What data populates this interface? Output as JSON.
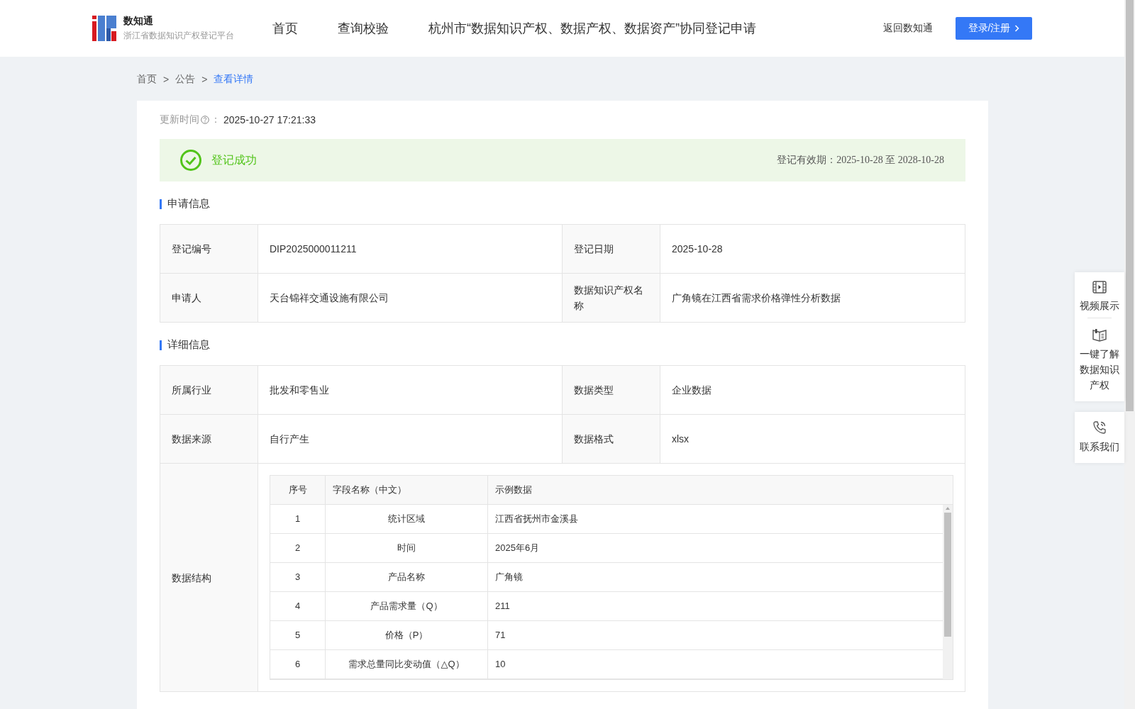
{
  "header": {
    "logo_title": "数知通",
    "logo_subtitle": "浙江省数据知识产权登记平台",
    "nav": [
      {
        "label": "首页"
      },
      {
        "label": "查询校验"
      },
      {
        "label": "杭州市“数据知识产权、数据产权、数据资产”协同登记申请"
      }
    ],
    "back_link": "返回数知通",
    "login_button": "登录/注册"
  },
  "breadcrumb": [
    {
      "kind": "link",
      "label": "首页",
      "selected": false
    },
    {
      "kind": "separator",
      "label": ">"
    },
    {
      "kind": "link",
      "label": "公告",
      "selected": false
    },
    {
      "kind": "separator",
      "label": ">"
    },
    {
      "kind": "link",
      "label": "查看详情",
      "selected": true
    }
  ],
  "update": {
    "label": "更新时间",
    "separator": "：",
    "value": "2025-10-27 17:21:33"
  },
  "status": {
    "kind": "success",
    "text": "登记成功",
    "validity_label": "登记有效期：",
    "validity_value": "2025-10-28 至 2028-10-28"
  },
  "sections": [
    {
      "title": "申请信息",
      "rows": [
        {
          "kind": "pairs",
          "cells": [
            {
              "label": "登记编号",
              "value": "DIP2025000011211"
            },
            {
              "label": "登记日期",
              "value": "2025-10-28"
            }
          ]
        },
        {
          "kind": "pairs",
          "cells": [
            {
              "label": "申请人",
              "value": "天台锦祥交通设施有限公司"
            },
            {
              "label": "数据知识产权名称",
              "value": "广角镜在江西省需求价格弹性分析数据"
            }
          ]
        }
      ]
    },
    {
      "title": "详细信息",
      "rows": [
        {
          "kind": "pairs",
          "cells": [
            {
              "label": "所属行业",
              "value": "批发和零售业"
            },
            {
              "label": "数据类型",
              "value": "企业数据"
            }
          ]
        },
        {
          "kind": "pairs",
          "cells": [
            {
              "label": "数据来源",
              "value": "自行产生"
            },
            {
              "label": "数据格式",
              "value": "xlsx"
            }
          ]
        },
        {
          "kind": "structure",
          "label": "数据结构",
          "columns": [
            "序号",
            "字段名称（中文）",
            "示例数据"
          ],
          "rows": [
            [
              "1",
              "统计区域",
              "江西省抚州市金溪县"
            ],
            [
              "2",
              "时间",
              "2025年6月"
            ],
            [
              "3",
              "产品名称",
              "广角镜"
            ],
            [
              "4",
              "产品需求量（Q）",
              "211"
            ],
            [
              "5",
              "价格（P）",
              "71"
            ],
            [
              "6",
              "需求总量同比变动值（△Q）",
              "10"
            ]
          ]
        }
      ]
    }
  ],
  "side_panel": {
    "items": [
      {
        "kind": "video",
        "label": "视频展示"
      },
      {
        "kind": "guide",
        "label": "一键了解数据知识产权"
      }
    ],
    "contact": {
      "kind": "phone",
      "label": "联系我们"
    }
  }
}
